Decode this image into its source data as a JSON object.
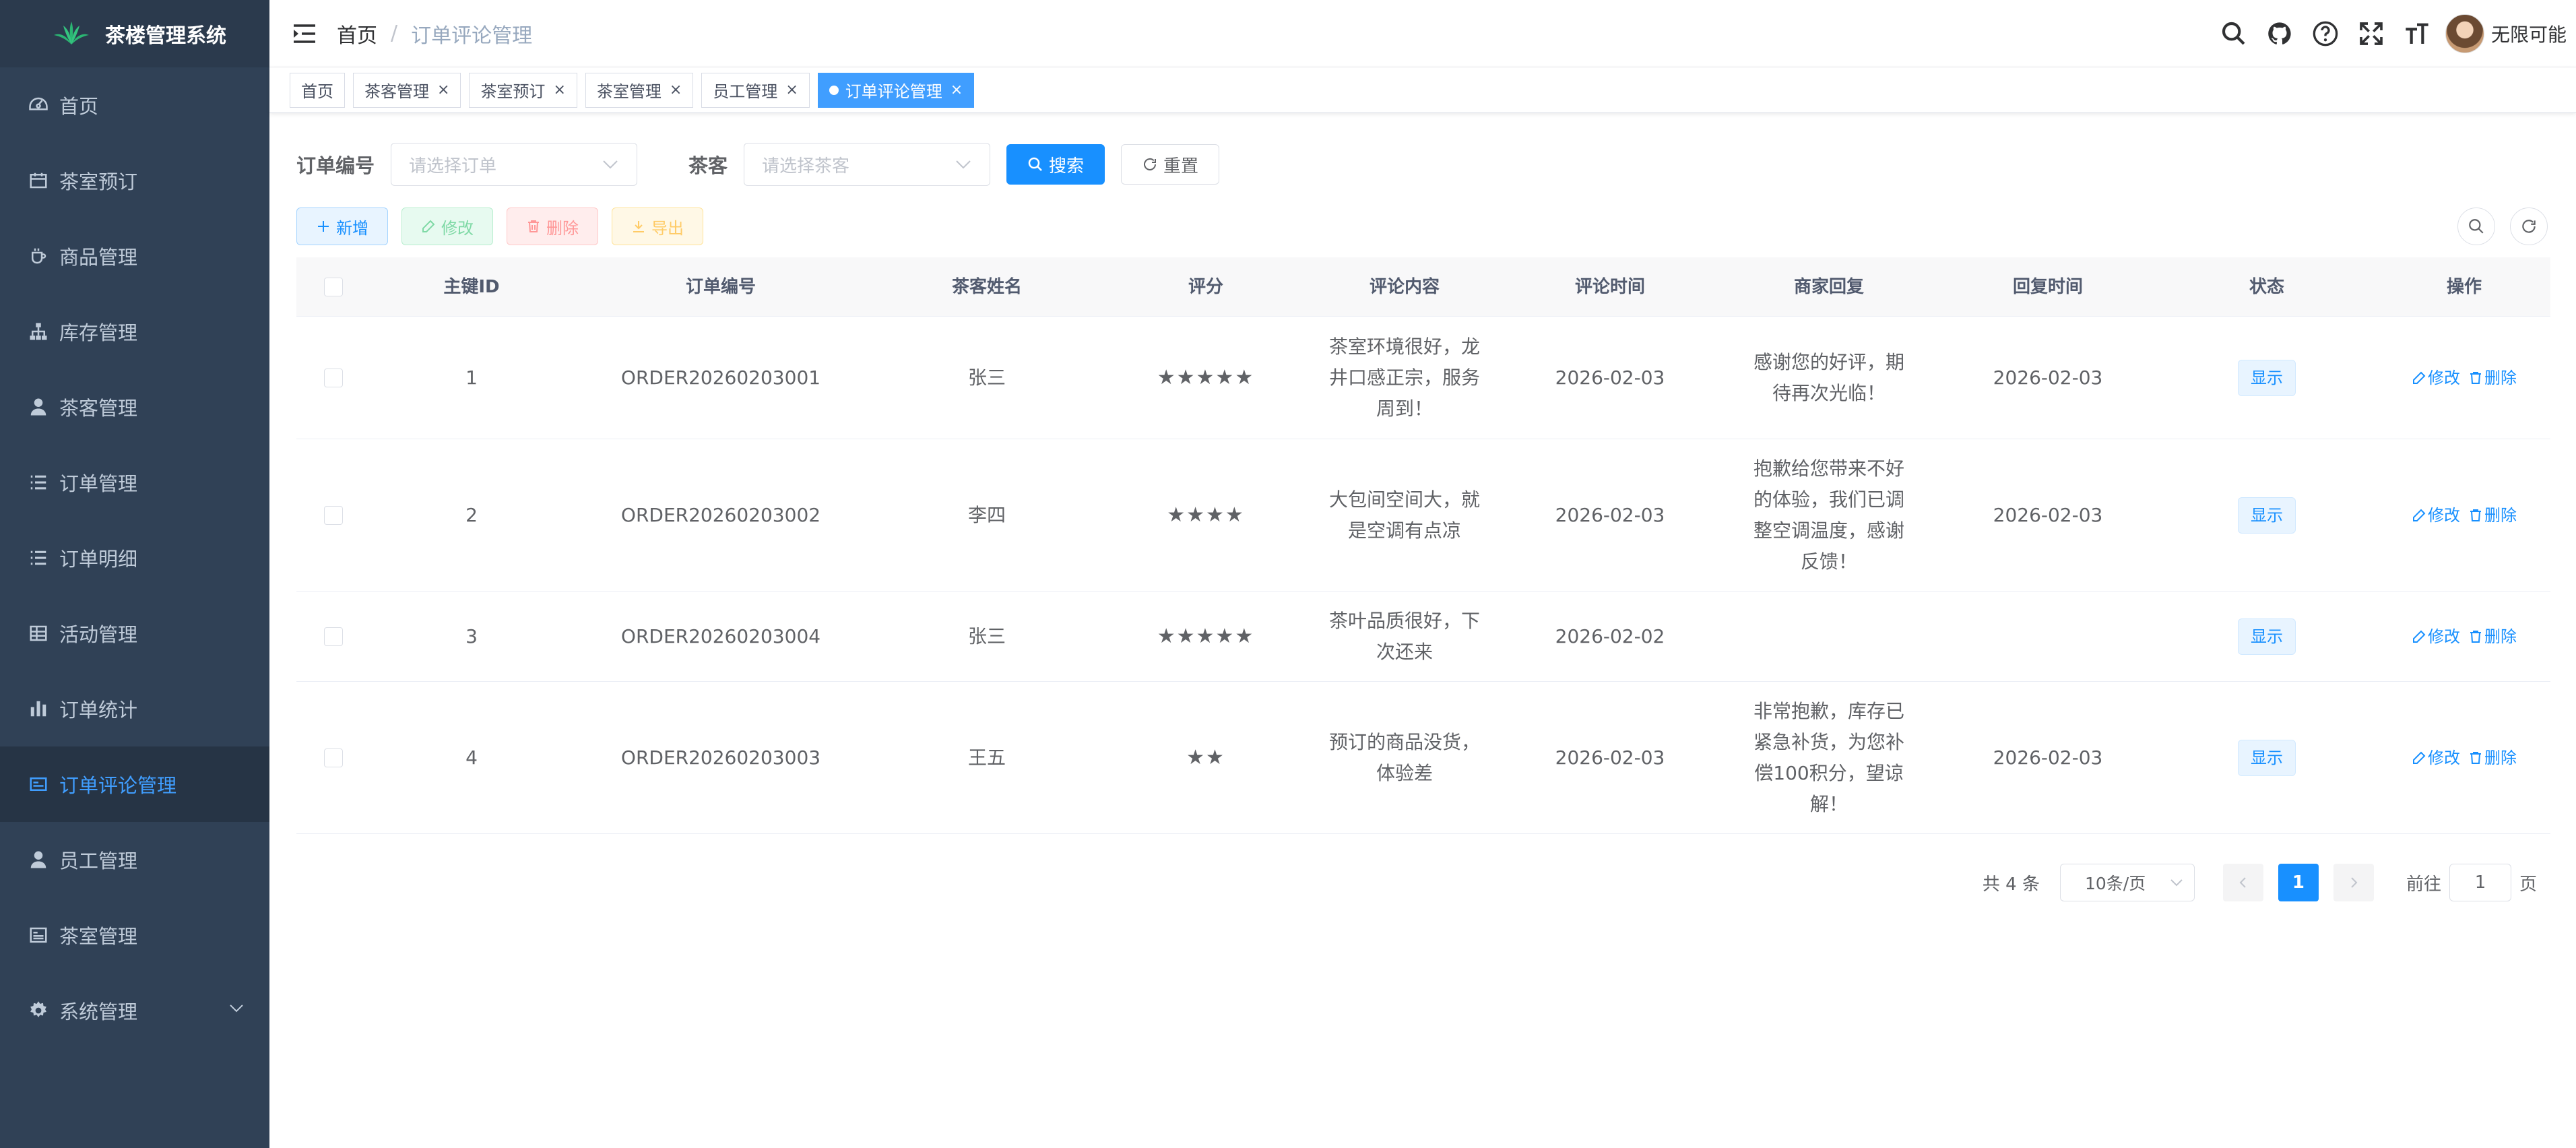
{
  "app": {
    "title": "茶楼管理系统"
  },
  "sidebar": {
    "items": [
      {
        "label": "首页",
        "icon": "dashboard-icon"
      },
      {
        "label": "茶室预订",
        "icon": "calendar-icon"
      },
      {
        "label": "商品管理",
        "icon": "cup-icon"
      },
      {
        "label": "库存管理",
        "icon": "tree-icon"
      },
      {
        "label": "茶客管理",
        "icon": "user-icon"
      },
      {
        "label": "订单管理",
        "icon": "list-icon"
      },
      {
        "label": "订单明细",
        "icon": "list-icon"
      },
      {
        "label": "活动管理",
        "icon": "grid-icon"
      },
      {
        "label": "订单统计",
        "icon": "bar-chart-icon"
      },
      {
        "label": "订单评论管理",
        "icon": "message-icon",
        "active": true
      },
      {
        "label": "员工管理",
        "icon": "user-icon"
      },
      {
        "label": "茶室管理",
        "icon": "server-icon"
      },
      {
        "label": "系统管理",
        "icon": "gear-icon"
      }
    ]
  },
  "header": {
    "breadcrumb": {
      "home": "首页",
      "separator": "/",
      "current": "订单评论管理"
    },
    "username": "无限可能"
  },
  "tags": [
    {
      "label": "首页",
      "closable": false
    },
    {
      "label": "茶客管理",
      "closable": true
    },
    {
      "label": "茶室预订",
      "closable": true
    },
    {
      "label": "茶室管理",
      "closable": true
    },
    {
      "label": "员工管理",
      "closable": true
    },
    {
      "label": "订单评论管理",
      "closable": true,
      "active": true
    }
  ],
  "search": {
    "order_label": "订单编号",
    "order_placeholder": "请选择订单",
    "customer_label": "茶客",
    "customer_placeholder": "请选择茶客",
    "search_label": "搜索",
    "reset_label": "重置"
  },
  "toolbar": {
    "add_label": "新增",
    "edit_label": "修改",
    "delete_label": "删除",
    "export_label": "导出"
  },
  "table": {
    "columns": [
      "主键ID",
      "订单编号",
      "茶客姓名",
      "评分",
      "评论内容",
      "评论时间",
      "商家回复",
      "回复时间",
      "状态",
      "操作"
    ],
    "rows": [
      {
        "id": "1",
        "order_no": "ORDER20260203001",
        "name": "张三",
        "rating": "★★★★★",
        "content": "茶室环境很好，龙井口感正宗，服务周到！",
        "comment_time": "2026-02-03",
        "reply": "感谢您的好评，期待再次光临！",
        "reply_time": "2026-02-03",
        "status": "显示",
        "edit": "修改",
        "delete": "删除"
      },
      {
        "id": "2",
        "order_no": "ORDER20260203002",
        "name": "李四",
        "rating": "★★★★",
        "content": "大包间空间大，就是空调有点凉",
        "comment_time": "2026-02-03",
        "reply": "抱歉给您带来不好的体验，我们已调整空调温度，感谢反馈！",
        "reply_time": "2026-02-03",
        "status": "显示",
        "edit": "修改",
        "delete": "删除"
      },
      {
        "id": "3",
        "order_no": "ORDER20260203004",
        "name": "张三",
        "rating": "★★★★★",
        "content": "茶叶品质很好，下次还来",
        "comment_time": "2026-02-02",
        "reply": "",
        "reply_time": "",
        "status": "显示",
        "edit": "修改",
        "delete": "删除"
      },
      {
        "id": "4",
        "order_no": "ORDER20260203003",
        "name": "王五",
        "rating": "★★",
        "content": "预订的商品没货，体验差",
        "comment_time": "2026-02-03",
        "reply": "非常抱歉，库存已紧急补货，为您补偿100积分，望谅解！",
        "reply_time": "2026-02-03",
        "status": "显示",
        "edit": "修改",
        "delete": "删除"
      }
    ]
  },
  "pagination": {
    "total_text": "共 4 条",
    "page_size": "10条/页",
    "current_page": "1",
    "goto_label": "前往",
    "goto_value": "1",
    "page_unit": "页"
  },
  "colors": {
    "sidebar_bg": "#304156",
    "active_menu_text": "#409eff",
    "primary": "#1890ff",
    "active_tag": "#409eff"
  }
}
